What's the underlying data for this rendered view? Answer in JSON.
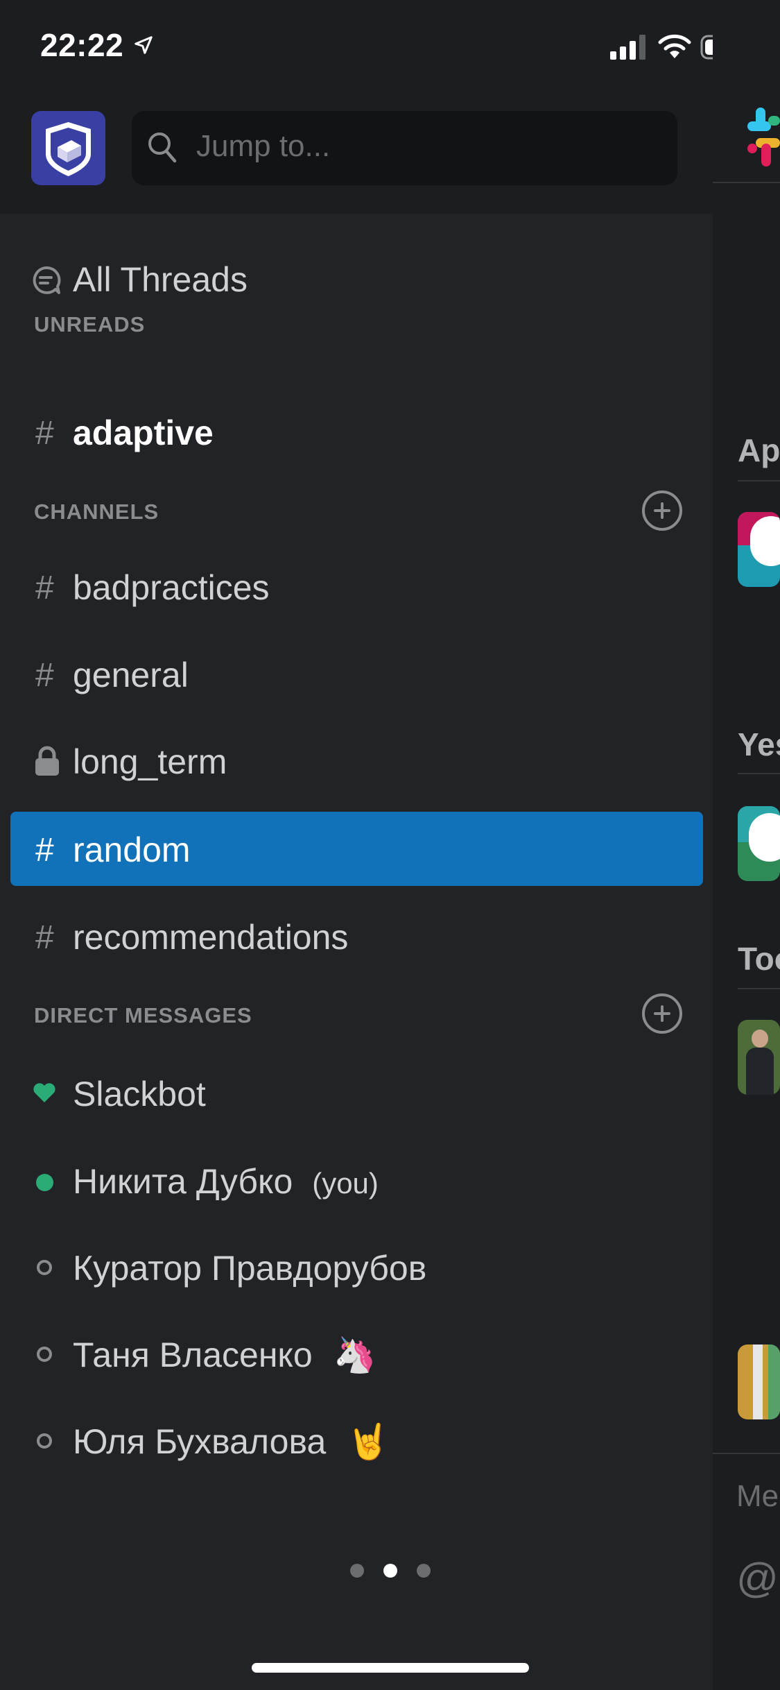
{
  "status_bar": {
    "time": "22:22"
  },
  "search": {
    "placeholder": "Jump to..."
  },
  "sidebar": {
    "all_threads_label": "All Threads",
    "unreads_label": "UNREADS",
    "unreads": [
      {
        "name": "adaptive",
        "type": "public"
      }
    ],
    "channels_label": "CHANNELS",
    "channels": [
      {
        "name": "badpractices",
        "type": "public"
      },
      {
        "name": "general",
        "type": "public"
      },
      {
        "name": "long_term",
        "type": "private"
      },
      {
        "name": "random",
        "type": "public",
        "selected": true
      },
      {
        "name": "recommendations",
        "type": "public"
      }
    ],
    "dm_label": "DIRECT MESSAGES",
    "dms": [
      {
        "name": "Slackbot",
        "status": "bot"
      },
      {
        "name": "Никита Дубко",
        "suffix": "(you)",
        "status": "online"
      },
      {
        "name": "Куратор Правдорубов",
        "status": "away"
      },
      {
        "name": "Таня Власенко",
        "emoji": "🦄",
        "status": "away"
      },
      {
        "name": "Юля Бухвалова",
        "emoji": "🤘",
        "status": "away"
      }
    ]
  },
  "right_panel": {
    "headings": [
      "Ap",
      "Yes",
      "Too"
    ],
    "message_placeholder": "Me",
    "mention_symbol": "@"
  },
  "pagination": {
    "pages": 3,
    "active_index": 1
  },
  "colors": {
    "accent": "#1171b9",
    "online": "#2bac76",
    "workspace_icon_bg": "#3a3fa3",
    "background": "#1b1d21"
  }
}
